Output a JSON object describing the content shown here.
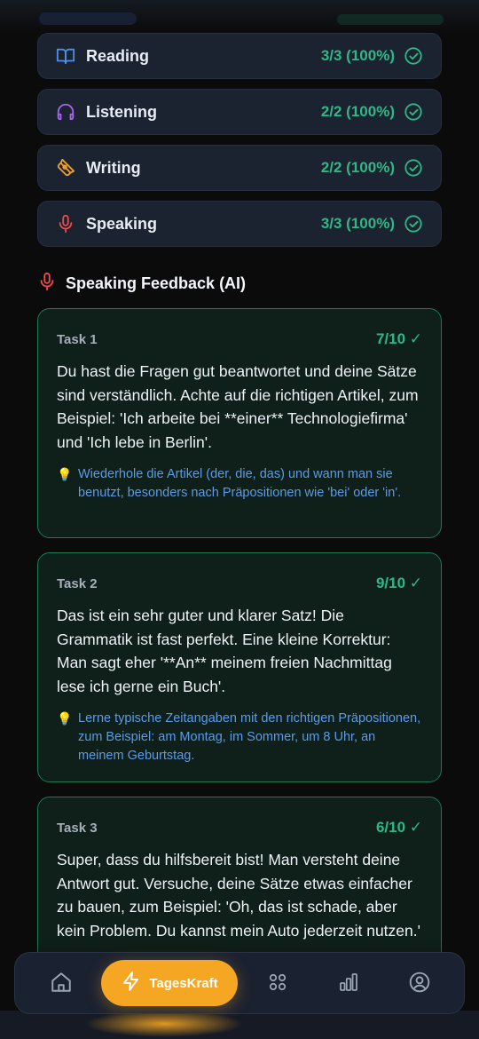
{
  "skills": [
    {
      "label": "Reading",
      "score": "3/3 (100%)",
      "icon": "book-open-icon",
      "color": "#4f8fe8"
    },
    {
      "label": "Listening",
      "score": "2/2 (100%)",
      "icon": "headphones-icon",
      "color": "#a465e8"
    },
    {
      "label": "Writing",
      "score": "2/2 (100%)",
      "icon": "pen-tool-icon",
      "color": "#f0a02c"
    },
    {
      "label": "Speaking",
      "score": "3/3 (100%)",
      "icon": "microphone-icon",
      "color": "#ef4b4b"
    }
  ],
  "feedback": {
    "title": "Speaking Feedback (AI)",
    "tasks": [
      {
        "name": "Task 1",
        "score": "7/10 ✓",
        "text": "Du hast die Fragen gut beantwortet und deine Sätze sind verständlich. Achte auf die richtigen Artikel, zum Beispiel: 'Ich arbeite bei **einer** Technologiefirma' und 'Ich lebe in Berlin'.",
        "tip": "Wiederhole die Artikel (der, die, das) und wann man sie benutzt, besonders nach Präpositionen wie 'bei' oder 'in'."
      },
      {
        "name": "Task 2",
        "score": "9/10 ✓",
        "text": "Das ist ein sehr guter und klarer Satz! Die Grammatik ist fast perfekt. Eine kleine Korrektur: Man sagt eher '**An** meinem freien Nachmittag lese ich gerne ein Buch'.",
        "tip": "Lerne typische Zeitangaben mit den richtigen Präpositionen, zum Beispiel: am Montag, im Sommer, um 8 Uhr, an meinem Geburtstag."
      },
      {
        "name": "Task 3",
        "score": "6/10 ✓",
        "text": "Super, dass du hilfsbereit bist! Man versteht deine Antwort gut. Versuche, deine Sätze etwas einfacher zu bauen, zum Beispiel: 'Oh, das ist schade, aber kein Problem. Du kannst mein Auto jederzeit nutzen.'"
      }
    ]
  },
  "tip_icon": "💡",
  "nav": {
    "primary_label": "TagesKraft",
    "items": [
      "home-icon",
      "lightning-icon",
      "grid-icon",
      "bar-chart-icon",
      "user-icon"
    ]
  },
  "colors": {
    "accent": "#f5a623",
    "success": "#2fb886",
    "tip": "#5b9be8"
  }
}
